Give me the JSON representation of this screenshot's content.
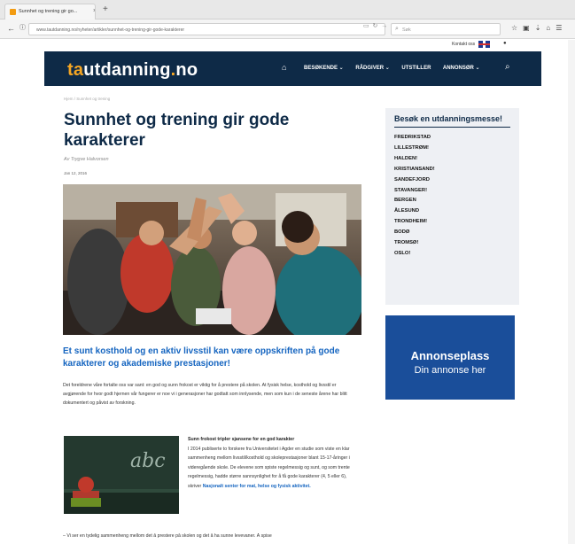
{
  "browser": {
    "tab_title": "Sunnhet og trening gir go...",
    "tab_close": "×",
    "new_tab": "+",
    "url": "www.tautdanning.no/nyheter/artikler/sunnhet-og-trening-gir-gode-karakterer",
    "search_placeholder": "Søk",
    "back": "←",
    "info": "ⓘ"
  },
  "topstrip": {
    "contact_label": "Kontakt oss"
  },
  "site": {
    "logo_ta": "ta",
    "logo_rest": "utdanning",
    "logo_dot": ".",
    "logo_tld": "no",
    "menu": [
      "BESØKENDE ⌄",
      "RÅDGIVER ⌄",
      "UTSTILLER",
      "ANNONSØR ⌄"
    ]
  },
  "article": {
    "breadcrumb": "Hjem / Sunnhet og trening",
    "title": "Sunnhet og trening gir gode karakterer",
    "byline": "Av Trygve Halvorsen",
    "date": "Jan 12, 2016",
    "lead": "Et sunt kosthold og en aktiv livsstil kan være oppskriften på gode karakterer og akademiske prestasjoner!",
    "body1": "Det foreldrene våre fortalte oss var sant: en god og sunn frokost er viktig for å prestere på skolen. At fysisk helse, kosthold og livsstil er avgjørende for hvor godt hjernen vår fungerer er noe vi i generasjoner har godtatt som innlysende, men som kun i de seneste årene har blitt dokumentert og påvist av forskning.",
    "side_heading": "Sunn frokost tripler sjansene for en god karakter",
    "side_body": "I 2014 publiserte to forskere fra Universitetet i Agder en studie som viste en klar sammenheng mellom livsstil/kosthold og skoleprestasjoner blant 15-17-åringer i videregående skole. De elevene som spiste regelmessig og sunt, og som trente regelmessig, hadde større sannsynlighet for å få gode karakterer (4, 5 eller 6), skriver",
    "side_link": "Nasjonalt senter for mat, helse og fysisk aktivitet.",
    "quote": "– Vi ser en tydelig sammenheng mellom det å prestere på skolen og det å ha sunne levevaner. Å spise"
  },
  "sidebar": {
    "messe_title": "Besøk en utdanningsmesse!",
    "cities": [
      "FREDRIKSTAD",
      "LILLESTRØM!",
      "HALDEN!",
      "KRISTIANSAND!",
      "SANDEFJORD",
      "STAVANGER!",
      "BERGEN",
      "ÅLESUND",
      "TRONDHEIM!",
      "BODØ",
      "TROMSØ!",
      "OSLO!"
    ],
    "ad_title": "Annonseplass",
    "ad_sub": "Din annonse her"
  },
  "colors": {
    "brand_navy": "#0e2a47",
    "brand_orange": "#f5a623",
    "link_blue": "#1565c0",
    "ad_blue": "#1a4e9a"
  }
}
